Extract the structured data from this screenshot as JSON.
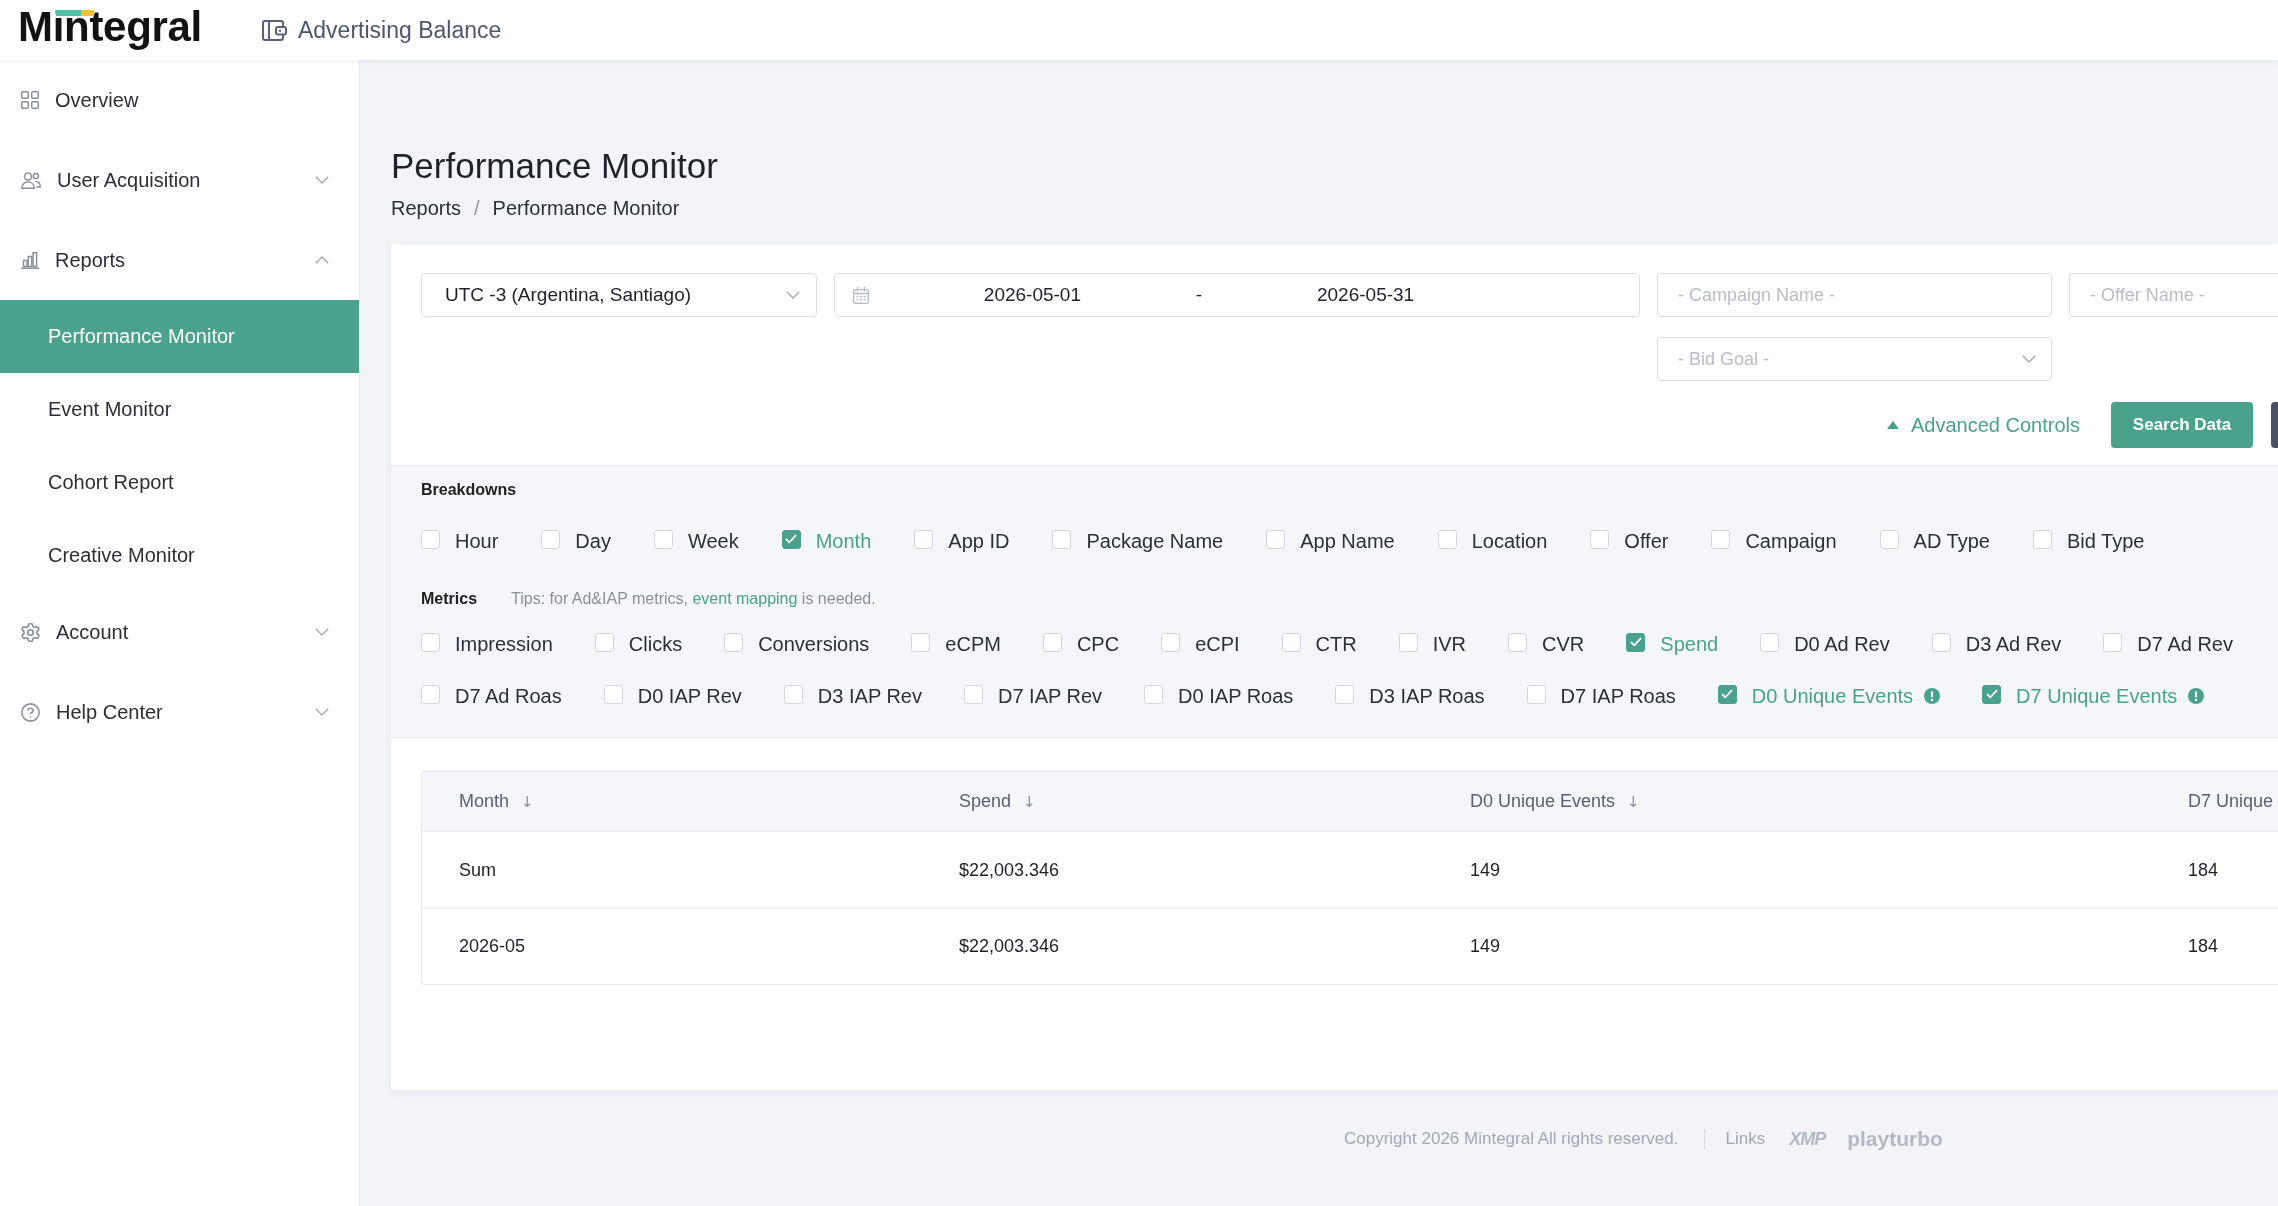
{
  "header": {
    "logo": "Mintegral",
    "balance_link": "Advertising Balance"
  },
  "sidebar": {
    "items": [
      {
        "label": "Overview"
      },
      {
        "label": "User Acquisition",
        "expanded": false
      },
      {
        "label": "Reports",
        "expanded": true,
        "children": [
          {
            "label": "Performance Monitor",
            "selected": true
          },
          {
            "label": "Event Monitor",
            "selected": false
          },
          {
            "label": "Cohort Report",
            "selected": false
          },
          {
            "label": "Creative Monitor",
            "selected": false
          }
        ]
      },
      {
        "label": "Account",
        "expanded": false
      },
      {
        "label": "Help Center",
        "expanded": false
      }
    ]
  },
  "page": {
    "title": "Performance Monitor",
    "breadcrumb": [
      "Reports",
      "Performance Monitor"
    ],
    "breadcrumb_separator": "/"
  },
  "filters": {
    "timezone": {
      "value": "UTC -3 (Argentina, Santiago)"
    },
    "date_range": {
      "start": "2026-05-01",
      "separator": "-",
      "end": "2026-05-31"
    },
    "campaign_name": {
      "placeholder": "- Campaign Name -"
    },
    "offer_name": {
      "placeholder": "- Offer Name -"
    },
    "bid_goal": {
      "placeholder": "- Bid Goal -"
    },
    "advanced_controls": {
      "label": "Advanced Controls",
      "expanded": true
    },
    "search_button": {
      "label": "Search Data"
    }
  },
  "breakdowns": {
    "label": "Breakdowns",
    "options": [
      {
        "label": "Hour",
        "checked": false
      },
      {
        "label": "Day",
        "checked": false
      },
      {
        "label": "Week",
        "checked": false
      },
      {
        "label": "Month",
        "checked": true
      },
      {
        "label": "App ID",
        "checked": false
      },
      {
        "label": "Package Name",
        "checked": false
      },
      {
        "label": "App Name",
        "checked": false
      },
      {
        "label": "Location",
        "checked": false
      },
      {
        "label": "Offer",
        "checked": false
      },
      {
        "label": "Campaign",
        "checked": false
      },
      {
        "label": "AD Type",
        "checked": false
      },
      {
        "label": "Bid Type",
        "checked": false
      }
    ]
  },
  "metrics": {
    "label": "Metrics",
    "tip": {
      "before": "Tips: for Ad&IAP metrics,",
      "link": "event mapping",
      "after": "is needed."
    },
    "options": [
      {
        "label": "Impression",
        "checked": false,
        "info_icon": false
      },
      {
        "label": "Clicks",
        "checked": false,
        "info_icon": false
      },
      {
        "label": "Conversions",
        "checked": false,
        "info_icon": false
      },
      {
        "label": "eCPM",
        "checked": false,
        "info_icon": false
      },
      {
        "label": "CPC",
        "checked": false,
        "info_icon": false
      },
      {
        "label": "eCPI",
        "checked": false,
        "info_icon": false
      },
      {
        "label": "CTR",
        "checked": false,
        "info_icon": false
      },
      {
        "label": "IVR",
        "checked": false,
        "info_icon": false
      },
      {
        "label": "CVR",
        "checked": false,
        "info_icon": false
      },
      {
        "label": "Spend",
        "checked": true,
        "info_icon": false
      },
      {
        "label": "D0 Ad Rev",
        "checked": false,
        "info_icon": false
      },
      {
        "label": "D3 Ad Rev",
        "checked": false,
        "info_icon": false
      },
      {
        "label": "D7 Ad Rev",
        "checked": false,
        "info_icon": false
      },
      {
        "label": "D7 Ad Roas",
        "checked": false,
        "info_icon": false
      },
      {
        "label": "D0 IAP Rev",
        "checked": false,
        "info_icon": false
      },
      {
        "label": "D3 IAP Rev",
        "checked": false,
        "info_icon": false
      },
      {
        "label": "D7 IAP Rev",
        "checked": false,
        "info_icon": false
      },
      {
        "label": "D0 IAP Roas",
        "checked": false,
        "info_icon": false
      },
      {
        "label": "D3 IAP Roas",
        "checked": false,
        "info_icon": false
      },
      {
        "label": "D7 IAP Roas",
        "checked": false,
        "info_icon": false
      },
      {
        "label": "D0 Unique Events",
        "checked": true,
        "info_icon": true
      },
      {
        "label": "D7 Unique Events",
        "checked": true,
        "info_icon": true
      }
    ]
  },
  "table": {
    "columns": [
      {
        "label": "Month",
        "sort_indicator": "↓"
      },
      {
        "label": "Spend",
        "sort_indicator": "↓"
      },
      {
        "label": "D0 Unique Events",
        "sort_indicator": "↓"
      },
      {
        "label": "D7 Unique"
      }
    ],
    "rows": [
      {
        "cells": [
          "Sum",
          "$22,003.346",
          "149",
          "184"
        ]
      },
      {
        "cells": [
          "2026-05",
          "$22,003.346",
          "149",
          "184"
        ]
      }
    ]
  },
  "footer": {
    "copyright": "Copyright 2026 Mintegral All rights reserved.",
    "links_label": "Links",
    "partners": [
      "XMP",
      "playturbo"
    ]
  }
}
